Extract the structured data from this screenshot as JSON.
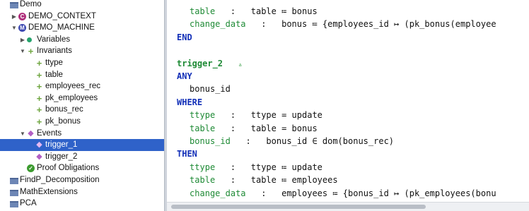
{
  "tree": [
    {
      "label": "Demo",
      "icon": "project-icon",
      "arrow": "",
      "depth": 0
    },
    {
      "label": "DEMO_CONTEXT",
      "icon": "context-icon",
      "arrow": "collapsed",
      "depth": 1
    },
    {
      "label": "DEMO_MACHINE",
      "icon": "machine-icon",
      "arrow": "expanded",
      "depth": 1
    },
    {
      "label": "Variables",
      "icon": "variables-icon",
      "arrow": "collapsed",
      "depth": 2
    },
    {
      "label": "Invariants",
      "icon": "invariants-icon",
      "arrow": "expanded",
      "depth": 2
    },
    {
      "label": "ttype",
      "icon": "invariant-icon",
      "arrow": "",
      "depth": 3
    },
    {
      "label": "table",
      "icon": "invariant-icon",
      "arrow": "",
      "depth": 3
    },
    {
      "label": "employees_rec",
      "icon": "invariant-icon",
      "arrow": "",
      "depth": 3
    },
    {
      "label": "pk_employees",
      "icon": "invariant-icon",
      "arrow": "",
      "depth": 3
    },
    {
      "label": "bonus_rec",
      "icon": "invariant-icon",
      "arrow": "",
      "depth": 3
    },
    {
      "label": "pk_bonus",
      "icon": "invariant-icon",
      "arrow": "",
      "depth": 3
    },
    {
      "label": "Events",
      "icon": "events-icon",
      "arrow": "expanded",
      "depth": 2
    },
    {
      "label": "trigger_1",
      "icon": "event-icon",
      "arrow": "",
      "depth": 3,
      "selected": true
    },
    {
      "label": "trigger_2",
      "icon": "event-icon",
      "arrow": "",
      "depth": 3
    },
    {
      "label": "Proof Obligations",
      "icon": "proof-obligations-icon",
      "arrow": "",
      "depth": 2
    },
    {
      "label": "FindP_Decomposition",
      "icon": "project-icon",
      "arrow": "",
      "depth": 0
    },
    {
      "label": "MathExtensions",
      "icon": "project-icon",
      "arrow": "",
      "depth": 0
    },
    {
      "label": "PCA",
      "icon": "project-icon",
      "arrow": "",
      "depth": 0
    }
  ],
  "editor": {
    "lines": [
      {
        "indent": 5,
        "parts": [
          {
            "t": "table",
            "c": "lab"
          },
          {
            "t": "   :   table ≔ bonus",
            "c": ""
          }
        ]
      },
      {
        "indent": 5,
        "parts": [
          {
            "t": "change_data",
            "c": "lab"
          },
          {
            "t": "   :   bonus ≔ {employees_id ↦ (pk_bonus(employee",
            "c": ""
          }
        ]
      },
      {
        "indent": 0,
        "parts": [
          {
            "t": "END",
            "c": "kw"
          }
        ]
      },
      {
        "indent": 0,
        "parts": []
      },
      {
        "indent": 0,
        "parts": [
          {
            "t": "trigger_2",
            "c": "tname"
          },
          {
            "t": "   ",
            "c": ""
          },
          {
            "t": "▵",
            "c": "tri"
          }
        ]
      },
      {
        "indent": 0,
        "parts": [
          {
            "t": "ANY",
            "c": "kw"
          }
        ]
      },
      {
        "indent": 5,
        "parts": [
          {
            "t": "bonus_id",
            "c": ""
          }
        ]
      },
      {
        "indent": 0,
        "parts": [
          {
            "t": "WHERE",
            "c": "kw"
          }
        ]
      },
      {
        "indent": 5,
        "parts": [
          {
            "t": "ttype",
            "c": "lab"
          },
          {
            "t": "   :   ttype = update",
            "c": ""
          }
        ]
      },
      {
        "indent": 5,
        "parts": [
          {
            "t": "table",
            "c": "lab"
          },
          {
            "t": "   :   table = bonus",
            "c": ""
          }
        ]
      },
      {
        "indent": 5,
        "parts": [
          {
            "t": "bonus_id",
            "c": "lab"
          },
          {
            "t": "   :   bonus_id ∈ dom(bonus_rec)",
            "c": ""
          }
        ]
      },
      {
        "indent": 0,
        "parts": [
          {
            "t": "THEN",
            "c": "kw"
          }
        ]
      },
      {
        "indent": 5,
        "parts": [
          {
            "t": "ttype",
            "c": "lab"
          },
          {
            "t": "   :   ttype ≔ update",
            "c": ""
          }
        ]
      },
      {
        "indent": 5,
        "parts": [
          {
            "t": "table",
            "c": "lab"
          },
          {
            "t": "   :   table ≔ employees",
            "c": ""
          }
        ]
      },
      {
        "indent": 5,
        "parts": [
          {
            "t": "change_data",
            "c": "lab"
          },
          {
            "t": "   :   employees ≔ {bonus_id ↦ (pk_employees(bonu",
            "c": ""
          }
        ]
      }
    ]
  },
  "colors": {
    "selection": "#2f62c9",
    "keyword": "#1330b8",
    "label": "#1e8a35"
  }
}
